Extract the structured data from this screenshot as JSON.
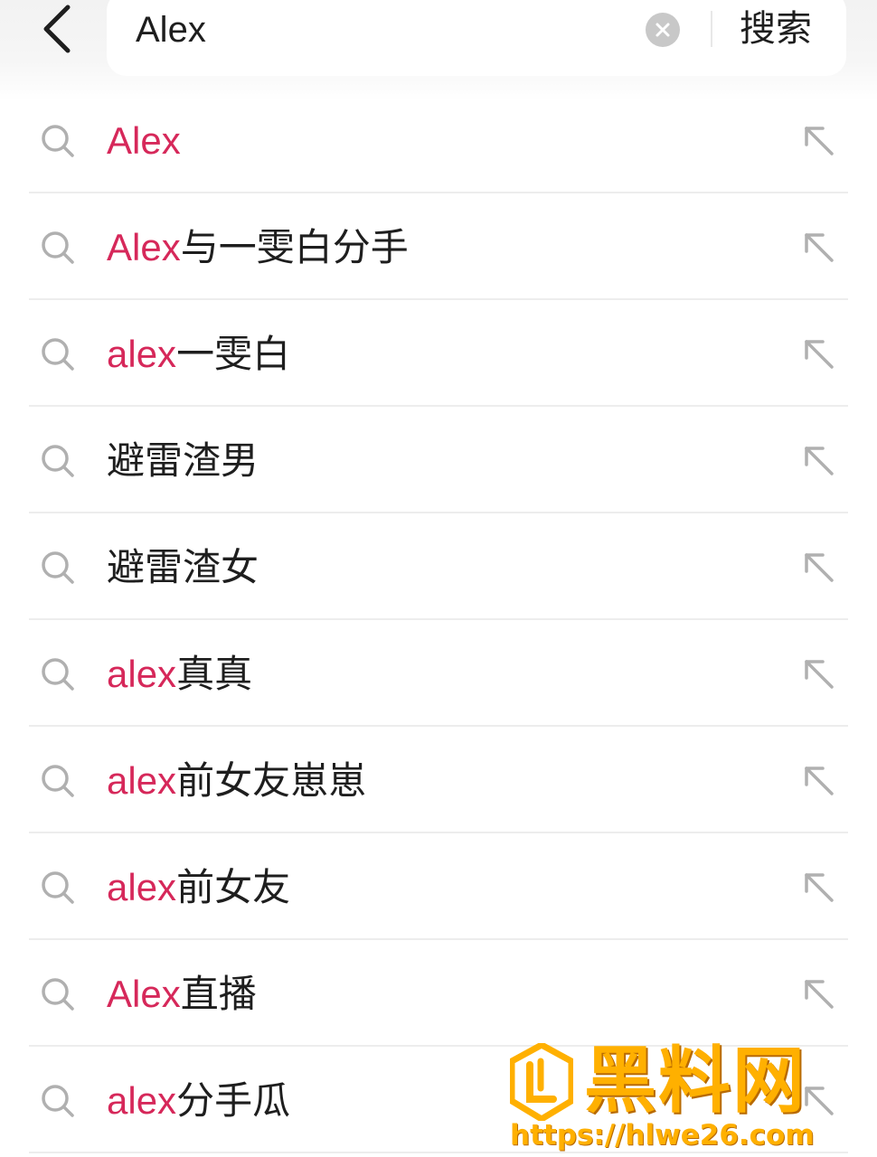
{
  "header": {
    "back_icon": "chevron-left-icon",
    "search_value": "Alex",
    "clear_icon": "clear-circle-icon",
    "search_button_label": "搜索"
  },
  "colors": {
    "highlight": "#d6285a",
    "text": "#1e1e1e",
    "icon_gray": "#b0b0b0"
  },
  "suggestions": [
    {
      "highlight": "Alex",
      "rest": ""
    },
    {
      "highlight": "Alex",
      "rest": "与一雯白分手"
    },
    {
      "highlight": "alex",
      "rest": "一雯白"
    },
    {
      "highlight": "",
      "rest": "避雷渣男"
    },
    {
      "highlight": "",
      "rest": "避雷渣女"
    },
    {
      "highlight": "alex",
      "rest": "真真"
    },
    {
      "highlight": "alex",
      "rest": "前女友崽崽"
    },
    {
      "highlight": "alex",
      "rest": "前女友"
    },
    {
      "highlight": "Alex",
      "rest": "直播"
    },
    {
      "highlight": "alex",
      "rest": "分手瓜"
    }
  ],
  "watermark": {
    "title": "黑料网",
    "url": "https://hlwe26.com"
  }
}
